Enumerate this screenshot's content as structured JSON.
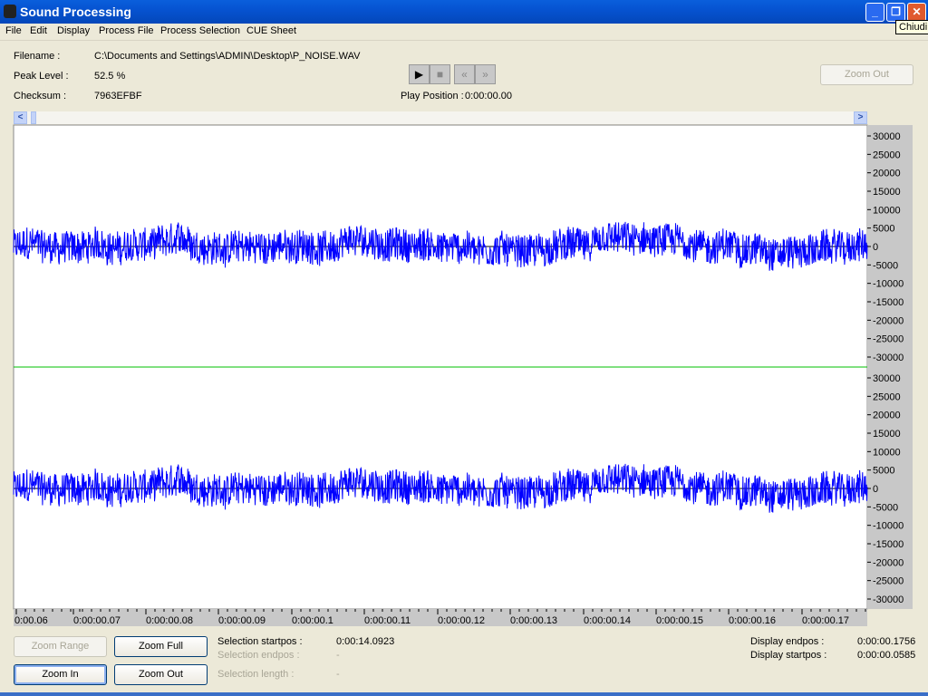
{
  "window": {
    "title": "Sound Processing",
    "tooltip": "Chiudi"
  },
  "menu": [
    "File",
    "Edit",
    "Display",
    "Process File",
    "Process Selection",
    "CUE Sheet"
  ],
  "info": {
    "filename_label": "Filename :",
    "filename": "C:\\Documents and Settings\\ADMIN\\Desktop\\P_NOISE.WAV",
    "peak_label": "Peak Level :",
    "peak": "52.5 %",
    "checksum_label": "Checksum :",
    "checksum": "7963EFBF",
    "play_label": "Play Position :",
    "play_position": "0:00:00.00"
  },
  "transport": {
    "play": "▶",
    "stop": "■",
    "rewind": "«",
    "forward": "»"
  },
  "buttons": {
    "zoom_out_top": "Zoom Out",
    "zoom_range": "Zoom Range",
    "zoom_full": "Zoom Full",
    "zoom_in": "Zoom In",
    "zoom_out": "Zoom Out"
  },
  "selection": {
    "start_label": "Selection startpos :",
    "start": "0:00:14.0923",
    "end_label": "Selection endpos :",
    "end": "-",
    "length_label": "Selection length :",
    "length": "-"
  },
  "display": {
    "end_label": "Display endpos :",
    "end": "0:00:00.1756",
    "start_label": "Display startpos :",
    "start": "0:00:00.0585"
  },
  "chart_data": {
    "type": "line",
    "channels": 2,
    "ylim": [
      -30000,
      30000
    ],
    "yticks": [
      30000,
      25000,
      20000,
      15000,
      10000,
      5000,
      0,
      -5000,
      -10000,
      -15000,
      -20000,
      -25000,
      -30000
    ],
    "xtick_labels": [
      "0:00.06",
      "0:00:00.07",
      "0:00:00.08",
      "0:00:00.09",
      "0:00:00.1",
      "0:00:00.11",
      "0:00:00.12",
      "0:00:00.13",
      "0:00:00.14",
      "0:00:00.15",
      "0:00:00.16",
      "0:00:00.17"
    ],
    "xlim": [
      "0:00:00.0585",
      "0:00:00.1756"
    ],
    "wave_color": "#0000ff",
    "divider_color": "#00c000",
    "zero_line_color": "#000000"
  }
}
